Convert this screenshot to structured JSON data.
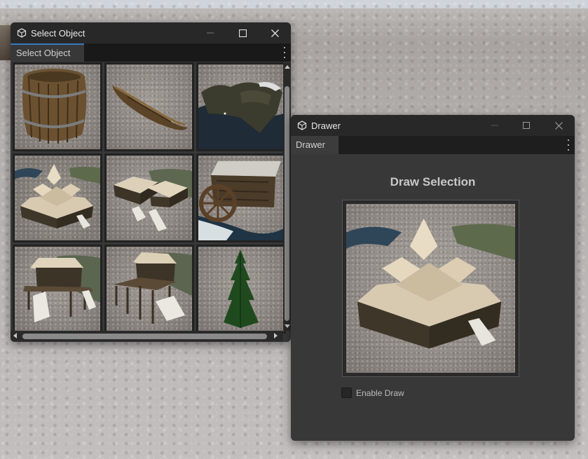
{
  "select_window": {
    "title": "Select Object",
    "tab_label": "Select Object",
    "items": [
      {
        "icon": "barrel-icon"
      },
      {
        "icon": "boat-icon"
      },
      {
        "icon": "terrain-icon"
      },
      {
        "icon": "longhouse-cross-icon"
      },
      {
        "icon": "longhouse-stairs-icon"
      },
      {
        "icon": "watermill-icon"
      },
      {
        "icon": "dock-house-icon"
      },
      {
        "icon": "stilt-house-icon"
      },
      {
        "icon": "pine-tree-icon"
      }
    ]
  },
  "drawer_window": {
    "title": "Drawer",
    "tab_label": "Drawer",
    "heading": "Draw Selection",
    "preview_icon": "longhouse-cross-icon",
    "enable_draw_label": "Enable Draw",
    "enable_draw_checked": false
  },
  "colors": {
    "titlebar": "#282828",
    "panel": "#383838",
    "tab_accent": "#3a79bb"
  }
}
